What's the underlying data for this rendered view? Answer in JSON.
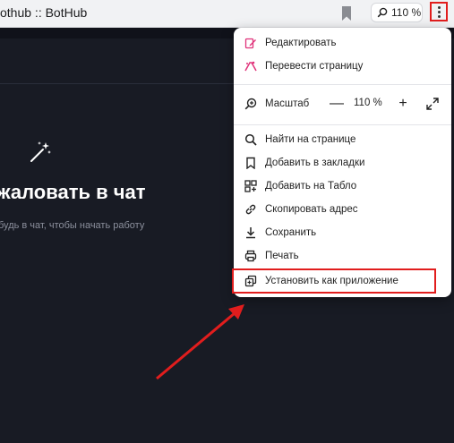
{
  "browser": {
    "tab_title": "othub :: BotHub",
    "zoom_chip": "110 %"
  },
  "page": {
    "welcome_title": "жаловать в чат",
    "welcome_subtitle": "будь в чат, чтобы начать работу"
  },
  "menu": {
    "items_top": [
      {
        "label": "Редактировать",
        "icon": "edit-icon"
      },
      {
        "label": "Перевести страницу",
        "icon": "translate-icon"
      }
    ],
    "zoom": {
      "label": "Масштаб",
      "minus": "—",
      "value": "110 %",
      "plus": "+"
    },
    "items_bottom": [
      {
        "label": "Найти на странице",
        "icon": "search-icon"
      },
      {
        "label": "Добавить в закладки",
        "icon": "bookmark-icon"
      },
      {
        "label": "Добавить на Табло",
        "icon": "grid-icon"
      },
      {
        "label": "Скопировать адрес",
        "icon": "link-icon"
      },
      {
        "label": "Сохранить",
        "icon": "download-icon"
      },
      {
        "label": "Печать",
        "icon": "print-icon"
      },
      {
        "label": "Установить как приложение",
        "icon": "install-app-icon"
      }
    ]
  },
  "colors": {
    "accent_pink": "#e0327a",
    "highlight_red": "#e11d1d",
    "page_bg": "#181b24"
  }
}
